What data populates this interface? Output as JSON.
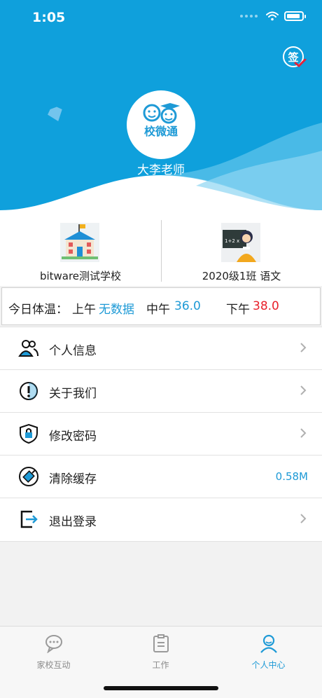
{
  "status_bar": {
    "time": "1:05"
  },
  "header": {
    "sign_in_label": "签",
    "teacher_name": "大李老师",
    "logo_text": "校微通"
  },
  "cards": {
    "school": {
      "label": "bitware测试学校",
      "icon": "school-building-icon"
    },
    "class": {
      "label": "2020级1班 语文",
      "icon": "teacher-at-blackboard-icon",
      "board_text": "1+2 x"
    }
  },
  "temperature": {
    "prefix": "今日体温：",
    "morning_label": "上午",
    "morning_value": "无数据",
    "noon_label": "中午",
    "noon_value": "36.0",
    "afternoon_label": "下午",
    "afternoon_value": "38.0"
  },
  "menu": {
    "items": [
      {
        "label": "个人信息",
        "icon": "user-group-icon"
      },
      {
        "label": "关于我们",
        "icon": "info-circle-icon"
      },
      {
        "label": "修改密码",
        "icon": "lock-shield-icon"
      },
      {
        "label": "清除缓存",
        "icon": "broom-circle-icon",
        "value": "0.58M"
      },
      {
        "label": "退出登录",
        "icon": "logout-icon"
      }
    ]
  },
  "tabbar": {
    "tabs": [
      {
        "label": "家校互动",
        "icon": "chat-bubbles-icon",
        "active": false
      },
      {
        "label": "工作",
        "icon": "clipboard-icon",
        "active": false
      },
      {
        "label": "个人中心",
        "icon": "person-icon",
        "active": true
      }
    ]
  },
  "colors": {
    "brand": "#0fa0dc",
    "accent_blue": "#1e9ad6",
    "alert_red": "#e8202a"
  }
}
